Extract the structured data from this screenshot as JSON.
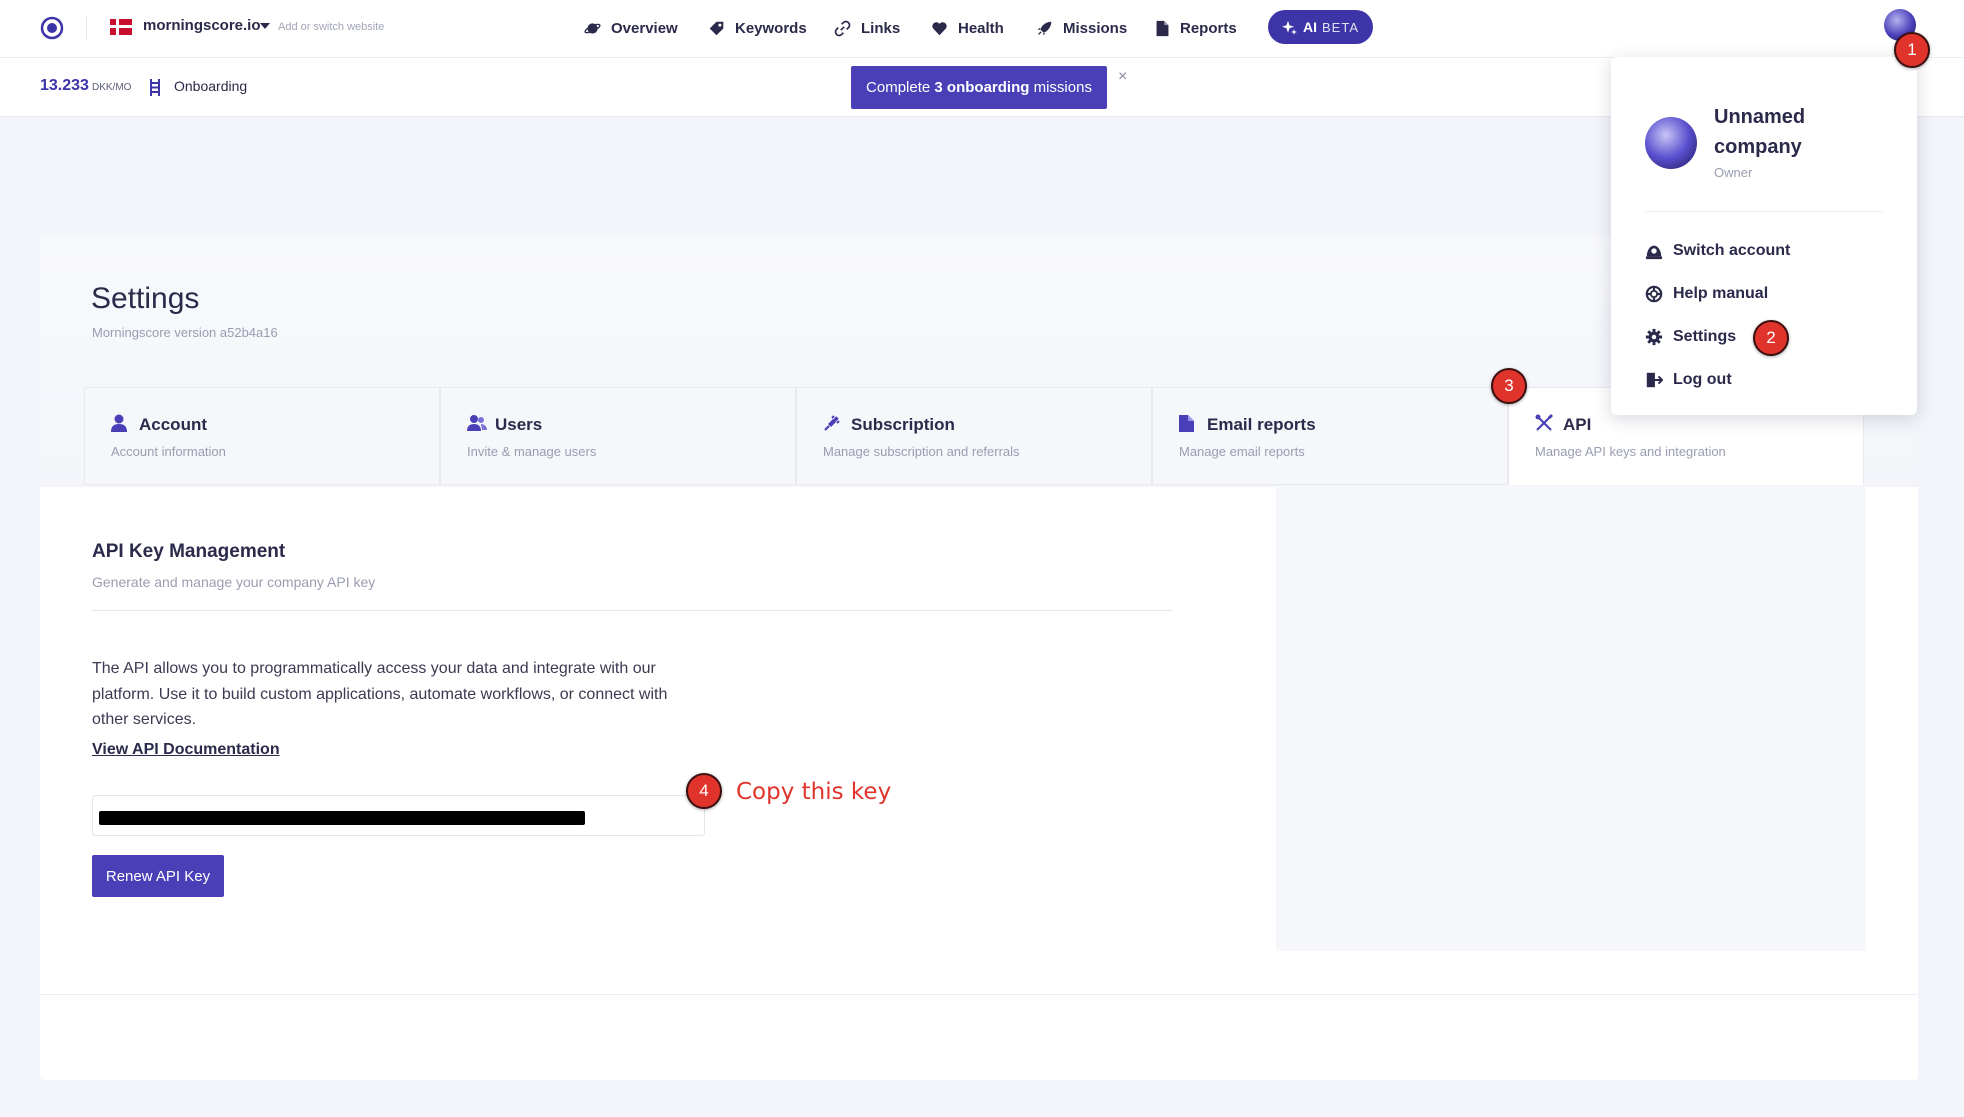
{
  "colors": {
    "accent": "#4b3fb8",
    "badge": "#e0332b",
    "annotation_text": "#e0332b"
  },
  "header": {
    "site_name": "morningscore.io",
    "site_hint": "Add or switch website",
    "nav": [
      {
        "label": "Overview",
        "icon": "planet-icon"
      },
      {
        "label": "Keywords",
        "icon": "tag-icon"
      },
      {
        "label": "Links",
        "icon": "link-icon"
      },
      {
        "label": "Health",
        "icon": "heart-icon"
      },
      {
        "label": "Missions",
        "icon": "rocket-icon"
      },
      {
        "label": "Reports",
        "icon": "document-icon"
      }
    ],
    "ai_label": "AI",
    "ai_badge": "BETA"
  },
  "subbar": {
    "score_value": "13.233",
    "score_unit": "DKK/MO",
    "onboarding_label": "Onboarding",
    "cta_prefix": "Complete",
    "cta_count": "3",
    "cta_bold": "onboarding",
    "cta_suffix": "missions",
    "close_glyph": "×"
  },
  "settings": {
    "title": "Settings",
    "version": "Morningscore version a52b4a16",
    "tabs": [
      {
        "label": "Account",
        "sub": "Account information",
        "icon": "user-icon"
      },
      {
        "label": "Users",
        "sub": "Invite & manage users",
        "icon": "users-icon"
      },
      {
        "label": "Subscription",
        "sub": "Manage subscription and referrals",
        "icon": "plug-icon"
      },
      {
        "label": "Email reports",
        "sub": "Manage email reports",
        "icon": "file-icon"
      },
      {
        "label": "API",
        "sub": "Manage API keys and integration",
        "icon": "tools-icon"
      }
    ],
    "active_tab": "API"
  },
  "api": {
    "heading": "API Key Management",
    "subheading": "Generate and manage your company API key",
    "description_lines": [
      "The API allows you to programmatically access your data and integrate with our",
      "platform. Use it to build custom applications, automate workflows, or connect with",
      "other services."
    ],
    "doc_link": "View API Documentation",
    "renew_label": "Renew API Key"
  },
  "dropdown": {
    "company_line1": "Unnamed",
    "company_line2": "company",
    "role": "Owner",
    "items": [
      {
        "label": "Switch account",
        "icon": "switch-account-icon"
      },
      {
        "label": "Help manual",
        "icon": "lifebuoy-icon"
      },
      {
        "label": "Settings",
        "icon": "gear-icon"
      },
      {
        "label": "Log out",
        "icon": "logout-icon"
      }
    ]
  },
  "annotations": {
    "badge1": "1",
    "badge2": "2",
    "badge3": "3",
    "badge4": "4",
    "copy_note": "Copy this key"
  }
}
